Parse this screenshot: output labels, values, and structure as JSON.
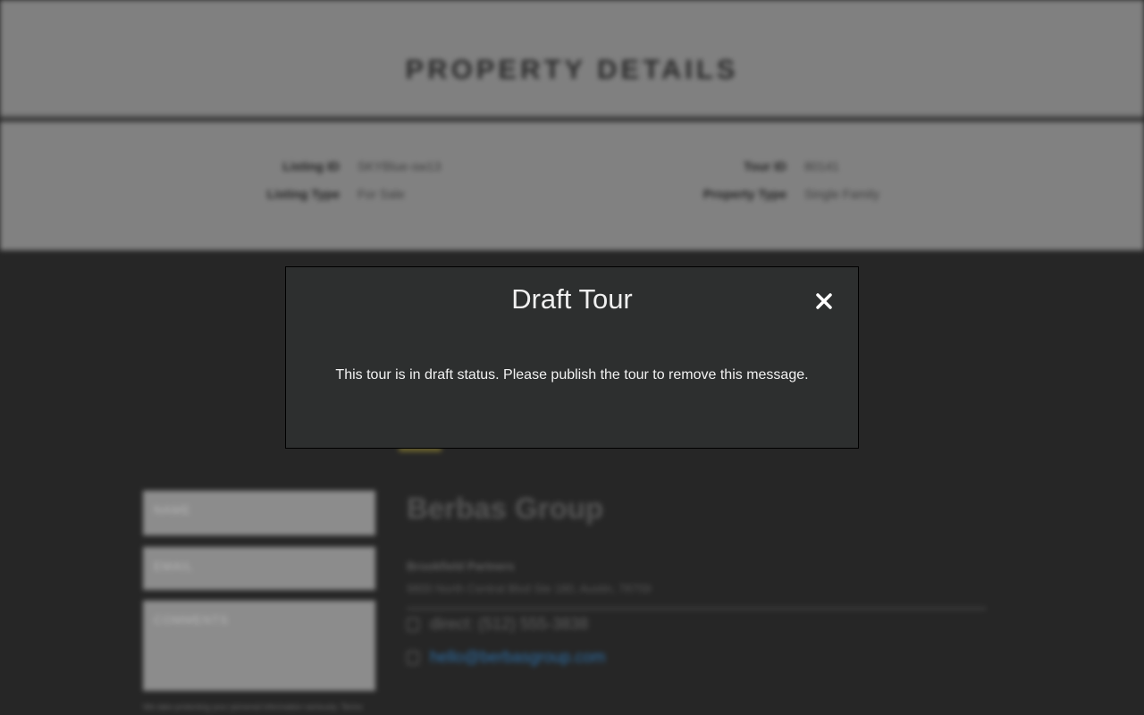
{
  "background_page": {
    "title": "PROPERTY DETAILS",
    "details": [
      {
        "label": "Listing ID",
        "value": "SKYBlue-sw13"
      },
      {
        "label": "Listing Type",
        "value": "For Sale"
      },
      {
        "label": "Tour ID",
        "value": "80141"
      },
      {
        "label": "Property Type",
        "value": "Single Family"
      }
    ],
    "form": {
      "name_placeholder": "NAME",
      "email_placeholder": "EMAIL",
      "comments_placeholder": "COMMENTS",
      "note": "We take protecting your personal information seriously. Terms",
      "note_link": "Terms"
    },
    "agent": {
      "company": "Berbas Group",
      "brokerage": "Brookfield Partners",
      "address": "9800 North Central Blvd Ste 180, Austin, 78759",
      "phone": "direct: (512) 555-3838",
      "email": "hello@berbasgroup.com"
    }
  },
  "modal": {
    "title": "Draft Tour",
    "message": "This tour is in draft status. Please publish the tour to remove this message.",
    "close_icon": "close-icon"
  },
  "colors": {
    "modal_bg": "#2d2f2f",
    "overlay_dark": "#262626",
    "header_gray": "#808080"
  }
}
